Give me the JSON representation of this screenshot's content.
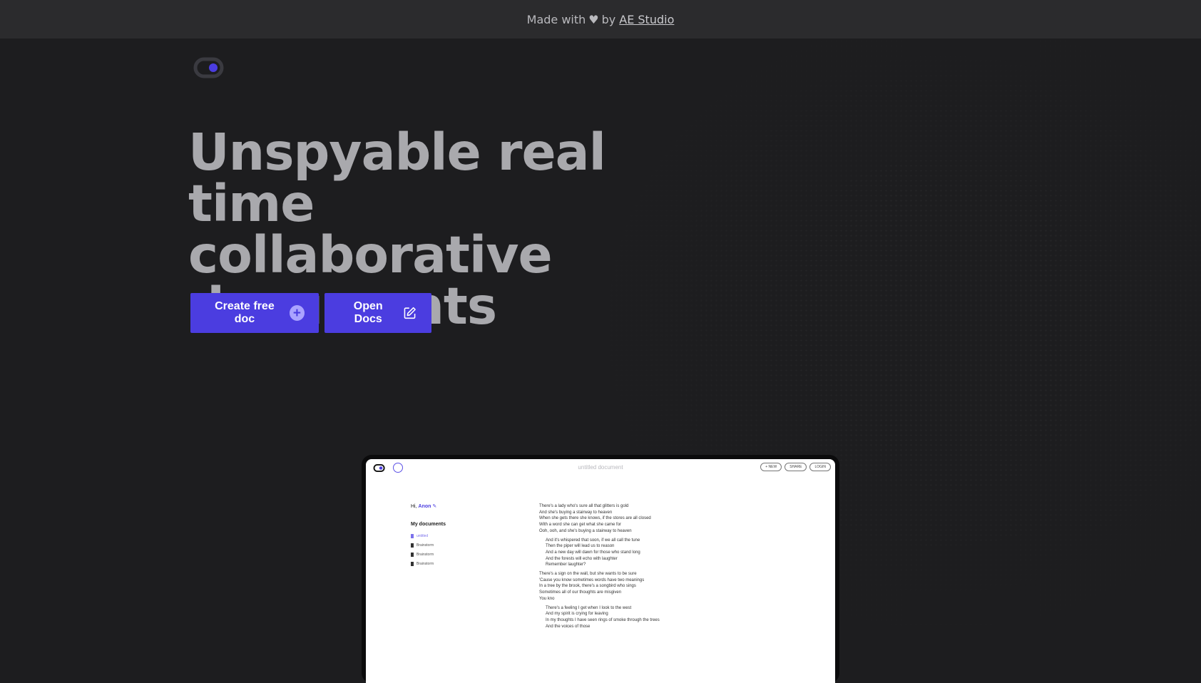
{
  "banner": {
    "prefix": "Made with",
    "heart": "♥",
    "by": "by",
    "link": "AE Studio"
  },
  "logo": {
    "name": "logo-icon",
    "accent": "#4b3de0"
  },
  "hero": {
    "lines": [
      "Unspyable real",
      "time collaborative",
      "documents"
    ]
  },
  "buttons": {
    "create": {
      "label": "Create free doc",
      "icon": "plus-circle-icon"
    },
    "open": {
      "label": "Open Docs",
      "icon": "edit-icon"
    }
  },
  "preview": {
    "doc_title": "untitled document",
    "top_buttons": [
      "+ NEW",
      "SHARE",
      "LOGIN"
    ],
    "greeting": "Hi,",
    "username": "Anon",
    "my_documents": "My documents",
    "documents": [
      "untitled",
      "Brainstorm",
      "Brainstorm",
      "Brainstorm"
    ],
    "stanzas": [
      {
        "indent": false,
        "lines": [
          "There's a lady who's sure all that glitters is gold",
          "And she's buying a stairway to heaven",
          "When she gets there she knows, if the stores are all closed",
          "With a word she can get what she came for",
          "Ooh, ooh, and she's buying a stairway to heaven"
        ]
      },
      {
        "indent": true,
        "lines": [
          "And it's whispered that soon, if we all call the tune",
          "Then the piper will lead us to reason",
          "And a new day will dawn for those who stand long",
          "And the forests will echo with laughter",
          "Remember laughter?"
        ]
      },
      {
        "indent": false,
        "lines": [
          "There's a sign on the wall, but she wants to be sure",
          "'Cause you know sometimes words have two meanings",
          "In a tree by the brook, there's a songbird who sings",
          "Sometimes all of our thoughts are misgiven",
          "You kno"
        ]
      },
      {
        "indent": true,
        "lines": [
          "There's a feeling I get when I look to the west",
          "And my spirit is crying for leaving",
          "In my thoughts I have seen rings of smoke through the trees",
          "And the voices of those"
        ]
      }
    ]
  },
  "colors": {
    "accent": "#4b3de0",
    "background": "#1d1d1f",
    "banner": "#2b2b2d"
  }
}
